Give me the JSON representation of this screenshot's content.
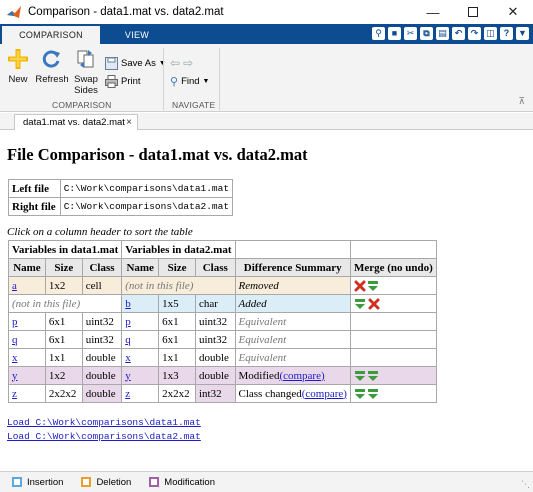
{
  "window": {
    "title": "Comparison - data1.mat vs. data2.mat",
    "controls": [
      "minimize-icon",
      "maximize-icon",
      "close-icon"
    ]
  },
  "ribbon": {
    "tabs": [
      "COMPARISON",
      "VIEW"
    ],
    "active_tab": "COMPARISON",
    "comparison_group": {
      "label": "COMPARISON",
      "new": "New",
      "refresh": "Refresh",
      "swap_line1": "Swap",
      "swap_line2": "Sides",
      "save_as": "Save As",
      "print": "Print"
    },
    "navigate_group": {
      "label": "NAVIGATE",
      "find": "Find"
    }
  },
  "doc_tab": {
    "label": "data1.mat vs. data2.mat"
  },
  "report": {
    "title": "File Comparison - data1.mat vs. data2.mat",
    "files": [
      {
        "label": "Left file",
        "path": "C:\\Work\\comparisons\\data1.mat"
      },
      {
        "label": "Right file",
        "path": "C:\\Work\\comparisons\\data2.mat"
      }
    ],
    "hint": "Click on a column header to sort the table",
    "group_headers": {
      "left": "Variables in data1.mat",
      "right": "Variables in data2.mat"
    },
    "columns": [
      "Name",
      "Size",
      "Class",
      "Name",
      "Size",
      "Class",
      "Difference Summary",
      "Merge (no undo)"
    ],
    "not_in_file": "(not in this file)",
    "rows": [
      {
        "kind": "del",
        "l_name": "a",
        "l_size": "1x2",
        "l_class": "cell",
        "r_name": "",
        "r_size": "",
        "r_class": "",
        "diff": "Removed",
        "diff_link": "",
        "merge": "remove"
      },
      {
        "kind": "ins",
        "l_name": "",
        "l_size": "",
        "l_class": "",
        "r_name": "b",
        "r_size": "1x5",
        "r_class": "char",
        "diff": "Added",
        "diff_link": "",
        "merge": "copy"
      },
      {
        "kind": "eq",
        "l_name": "p",
        "l_size": "6x1",
        "l_class": "uint32",
        "r_name": "p",
        "r_size": "6x1",
        "r_class": "uint32",
        "diff": "Equivalent",
        "diff_link": "",
        "merge": ""
      },
      {
        "kind": "eq",
        "l_name": "q",
        "l_size": "6x1",
        "l_class": "uint32",
        "r_name": "q",
        "r_size": "6x1",
        "r_class": "uint32",
        "diff": "Equivalent",
        "diff_link": "",
        "merge": ""
      },
      {
        "kind": "eq",
        "l_name": "x",
        "l_size": "1x1",
        "l_class": "double",
        "r_name": "x",
        "r_size": "1x1",
        "r_class": "double",
        "diff": "Equivalent",
        "diff_link": "",
        "merge": ""
      },
      {
        "kind": "mod-size",
        "l_name": "y",
        "l_size": "1x2",
        "l_class": "double",
        "r_name": "y",
        "r_size": "1x3",
        "r_class": "double",
        "diff": "Modified",
        "diff_link": "(compare)",
        "merge": "both"
      },
      {
        "kind": "mod-class",
        "l_name": "z",
        "l_size": "2x2x2",
        "l_class": "double",
        "r_name": "z",
        "r_size": "2x2x2",
        "r_class": "int32",
        "diff": "Class changed",
        "diff_link": "(compare)",
        "merge": "both"
      }
    ],
    "load_links": [
      "Load C:\\Work\\comparisons\\data1.mat",
      "Load C:\\Work\\comparisons\\data2.mat"
    ]
  },
  "legend": {
    "items": [
      {
        "label": "Insertion",
        "color": "#5aa8e0"
      },
      {
        "label": "Deletion",
        "color": "#e8a030"
      },
      {
        "label": "Modification",
        "color": "#a060a8"
      }
    ]
  }
}
